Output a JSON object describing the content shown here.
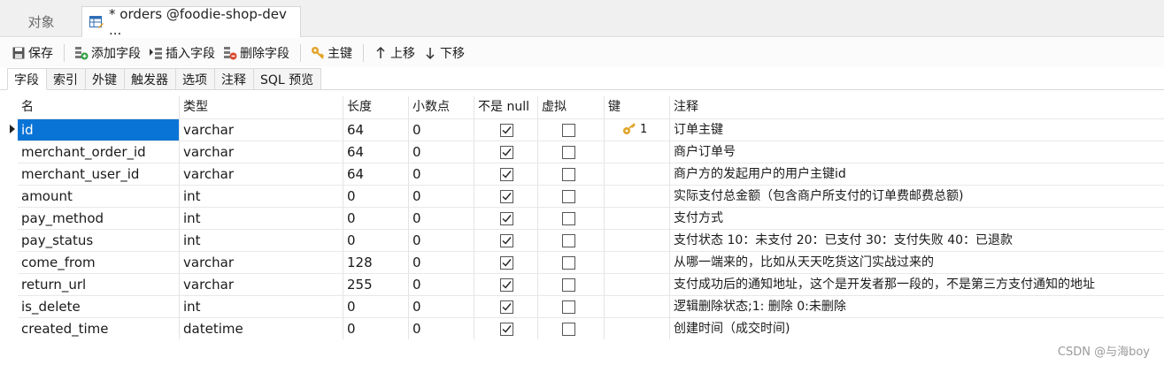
{
  "doc_tabs": {
    "objects_label": "对象",
    "active_tab_label": "* orders @foodie-shop-dev ..."
  },
  "toolbar": {
    "save": "保存",
    "add_field": "添加字段",
    "insert_field": "插入字段",
    "delete_field": "删除字段",
    "primary_key": "主键",
    "move_up": "上移",
    "move_down": "下移"
  },
  "subtabs": [
    "字段",
    "索引",
    "外键",
    "触发器",
    "选项",
    "注释",
    "SQL 预览"
  ],
  "columns": {
    "name": "名",
    "type": "类型",
    "length": "长度",
    "decimals": "小数点",
    "not_null": "不是 null",
    "virtual": "虚拟",
    "key": "键",
    "comment": "注释"
  },
  "rows": [
    {
      "name": "id",
      "type": "varchar",
      "length": "64",
      "decimals": "0",
      "not_null": true,
      "virtual": false,
      "key": "1",
      "comment": "订单主键"
    },
    {
      "name": "merchant_order_id",
      "type": "varchar",
      "length": "64",
      "decimals": "0",
      "not_null": true,
      "virtual": false,
      "key": "",
      "comment": "商户订单号"
    },
    {
      "name": "merchant_user_id",
      "type": "varchar",
      "length": "64",
      "decimals": "0",
      "not_null": true,
      "virtual": false,
      "key": "",
      "comment": "商户方的发起用户的用户主键id"
    },
    {
      "name": "amount",
      "type": "int",
      "length": "0",
      "decimals": "0",
      "not_null": true,
      "virtual": false,
      "key": "",
      "comment": "实际支付总金额（包含商户所支付的订单费邮费总额)"
    },
    {
      "name": "pay_method",
      "type": "int",
      "length": "0",
      "decimals": "0",
      "not_null": true,
      "virtual": false,
      "key": "",
      "comment": "支付方式"
    },
    {
      "name": "pay_status",
      "type": "int",
      "length": "0",
      "decimals": "0",
      "not_null": true,
      "virtual": false,
      "key": "",
      "comment": "支付状态 10：未支付 20：已支付 30：支付失败 40：已退款"
    },
    {
      "name": "come_from",
      "type": "varchar",
      "length": "128",
      "decimals": "0",
      "not_null": true,
      "virtual": false,
      "key": "",
      "comment": "从哪一端来的，比如从天天吃货这门实战过来的"
    },
    {
      "name": "return_url",
      "type": "varchar",
      "length": "255",
      "decimals": "0",
      "not_null": true,
      "virtual": false,
      "key": "",
      "comment": "支付成功后的通知地址，这个是开发者那一段的，不是第三方支付通知的地址"
    },
    {
      "name": "is_delete",
      "type": "int",
      "length": "0",
      "decimals": "0",
      "not_null": true,
      "virtual": false,
      "key": "",
      "comment": "逻辑删除状态;1: 删除 0:未删除"
    },
    {
      "name": "created_time",
      "type": "datetime",
      "length": "0",
      "decimals": "0",
      "not_null": true,
      "virtual": false,
      "key": "",
      "comment": "创建时间（成交时间)"
    }
  ],
  "watermark": "CSDN @与海boy",
  "colors": {
    "selection": "#0a74d6",
    "key_icon": "#e2a42b",
    "add_icon": "#2e9e3e",
    "delete_icon": "#d9482b"
  }
}
